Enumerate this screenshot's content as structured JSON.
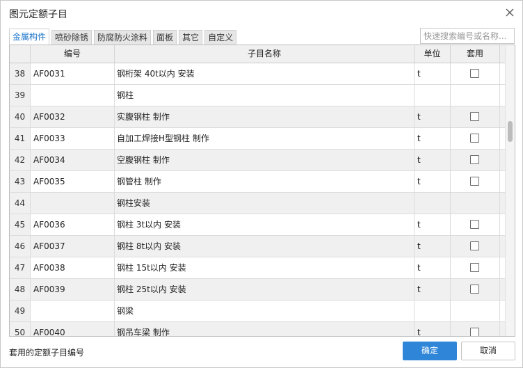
{
  "dialog": {
    "title": "图元定额子目"
  },
  "tabs": [
    {
      "label": "金属构件",
      "active": true
    },
    {
      "label": "喷砂除锈",
      "active": false
    },
    {
      "label": "防腐防火涂料",
      "active": false
    },
    {
      "label": "面板",
      "active": false
    },
    {
      "label": "其它",
      "active": false
    },
    {
      "label": "自定义",
      "active": false
    }
  ],
  "search": {
    "placeholder": "快速搜索编号或名称..."
  },
  "table": {
    "columns": {
      "number": "",
      "code": "编号",
      "name": "子目名称",
      "unit": "单位",
      "apply": "套用"
    },
    "rows": [
      {
        "num": "38",
        "code": "AF0031",
        "name": "钢桁架 40t以内 安装",
        "unit": "t",
        "checkbox": true,
        "checked": false,
        "group": false
      },
      {
        "num": "39",
        "code": "",
        "name": "钢柱",
        "unit": "",
        "checkbox": false,
        "checked": false,
        "group": false
      },
      {
        "num": "40",
        "code": "AF0032",
        "name": "实腹钢柱 制作",
        "unit": "t",
        "checkbox": true,
        "checked": false,
        "group": true
      },
      {
        "num": "41",
        "code": "AF0033",
        "name": "自加工焊接H型钢柱 制作",
        "unit": "t",
        "checkbox": true,
        "checked": false,
        "group": false
      },
      {
        "num": "42",
        "code": "AF0034",
        "name": "空腹钢柱 制作",
        "unit": "t",
        "checkbox": true,
        "checked": false,
        "group": true
      },
      {
        "num": "43",
        "code": "AF0035",
        "name": "钢管柱 制作",
        "unit": "t",
        "checkbox": true,
        "checked": false,
        "group": false
      },
      {
        "num": "44",
        "code": "",
        "name": "钢柱安装",
        "unit": "",
        "checkbox": false,
        "checked": false,
        "group": true
      },
      {
        "num": "45",
        "code": "AF0036",
        "name": "钢柱 3t以内 安装",
        "unit": "t",
        "checkbox": true,
        "checked": false,
        "group": false
      },
      {
        "num": "46",
        "code": "AF0037",
        "name": "钢柱 8t以内 安装",
        "unit": "t",
        "checkbox": true,
        "checked": false,
        "group": true
      },
      {
        "num": "47",
        "code": "AF0038",
        "name": "钢柱 15t以内 安装",
        "unit": "t",
        "checkbox": true,
        "checked": false,
        "group": false
      },
      {
        "num": "48",
        "code": "AF0039",
        "name": "钢柱 25t以内 安装",
        "unit": "t",
        "checkbox": true,
        "checked": false,
        "group": true
      },
      {
        "num": "49",
        "code": "",
        "name": "钢梁",
        "unit": "",
        "checkbox": false,
        "checked": false,
        "group": false
      },
      {
        "num": "50",
        "code": "AF0040",
        "name": "钢吊车梁 制作",
        "unit": "t",
        "checkbox": true,
        "checked": false,
        "group": true
      }
    ]
  },
  "footer": {
    "hint": "套用的定额子目编号",
    "ok_label": "确定",
    "cancel_label": "取消"
  },
  "colors": {
    "accent": "#2f86d8",
    "tab_active_text": "#1a73c9",
    "header_bg": "#f0f0f0"
  },
  "icons": {
    "close": "close-icon"
  }
}
